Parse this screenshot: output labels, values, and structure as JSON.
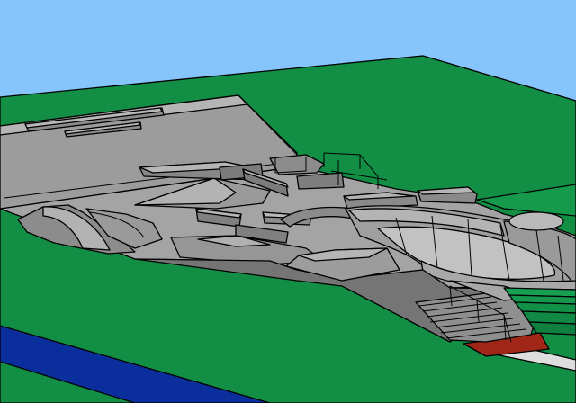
{
  "scene": {
    "subject": "skatepark-3d-model",
    "colors": {
      "sky": "#86c4fc",
      "grass": "#128f45",
      "concrete_light": "#a7a7a7",
      "concrete_mid": "#8f8f8f",
      "concrete_dark": "#6e6e6e",
      "concrete_shadow": "#5c5c5c",
      "water": "#0a2f9c",
      "path": "#dedede",
      "red_strip": "#a02618",
      "outline": "#000000"
    }
  }
}
